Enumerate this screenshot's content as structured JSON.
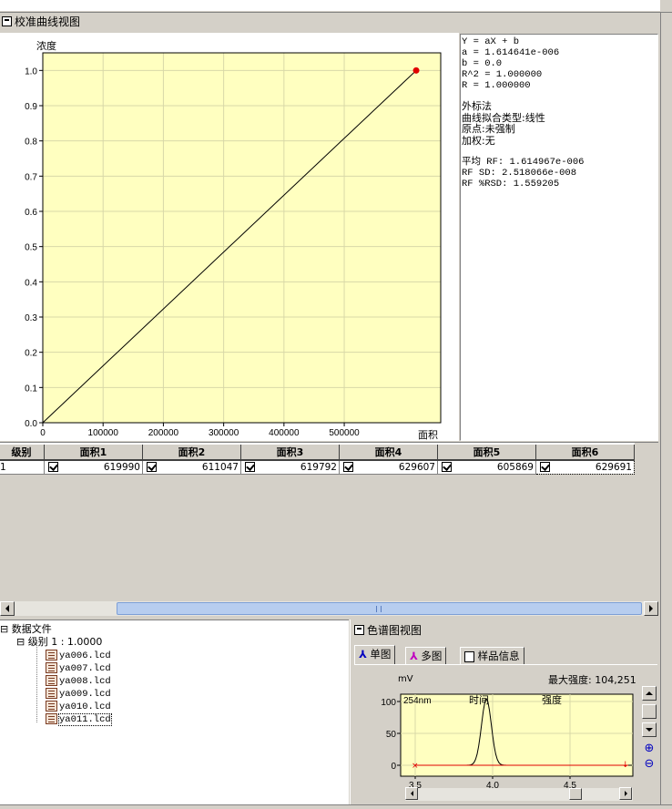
{
  "calibration_panel": {
    "title": "校准曲线视图",
    "y_axis_label": "浓度",
    "x_axis_label": "面积",
    "chart_data": {
      "type": "line",
      "xlabel": "面积",
      "ylabel": "浓度",
      "xlim": [
        0,
        660000
      ],
      "ylim": [
        0,
        1.05
      ],
      "x_ticks": [
        "0",
        "100000",
        "200000",
        "300000",
        "400000",
        "500000"
      ],
      "y_ticks": [
        "0.0",
        "0.1",
        "0.2",
        "0.3",
        "0.4",
        "0.5",
        "0.6",
        "0.7",
        "0.8",
        "0.9",
        "1.0"
      ],
      "grid": true,
      "series": [
        {
          "x": [
            0,
            619299
          ],
          "y": [
            0,
            1.0
          ]
        }
      ],
      "points": [
        {
          "x": 619299,
          "y": 1.0
        }
      ]
    }
  },
  "info": {
    "lines1": [
      "Y = aX + b",
      "a = 1.614641e-006",
      "b = 0.0",
      "R^2 = 1.000000",
      "R = 1.000000"
    ],
    "lines2": [
      "外标法",
      "曲线拟合类型:线性",
      "原点:未强制",
      "加权:无"
    ],
    "lines3": [
      "平均 RF:  1.614967e-006",
      "RF SD: 2.518066e-008",
      "RF %RSD: 1.559205"
    ]
  },
  "table": {
    "level_header": "级别",
    "level_value": "1",
    "headers": [
      "面积1",
      "面积2",
      "面积3",
      "面积4",
      "面积5",
      "面积6"
    ],
    "values": [
      "619990",
      "611047",
      "619792",
      "629607",
      "605869",
      "629691"
    ]
  },
  "tree": {
    "root": "数据文件",
    "level": "级别  1 : 1.0000",
    "files": [
      "ya006.lcd",
      "ya007.lcd",
      "ya008.lcd",
      "ya009.lcd",
      "ya010.lcd",
      "ya011.lcd"
    ]
  },
  "chromatogram": {
    "title": "色谱图视图",
    "tabs": [
      "单图",
      "多图",
      "样品信息"
    ],
    "unit": "mV",
    "max_intensity": "最大强度: 104,251",
    "wavelength": "254nm",
    "label_time": "时间",
    "label_intensity": "强度",
    "y_ticks": [
      "100",
      "50",
      "0"
    ],
    "x_ticks": [
      "3.5",
      "4.0",
      "4.5"
    ]
  }
}
